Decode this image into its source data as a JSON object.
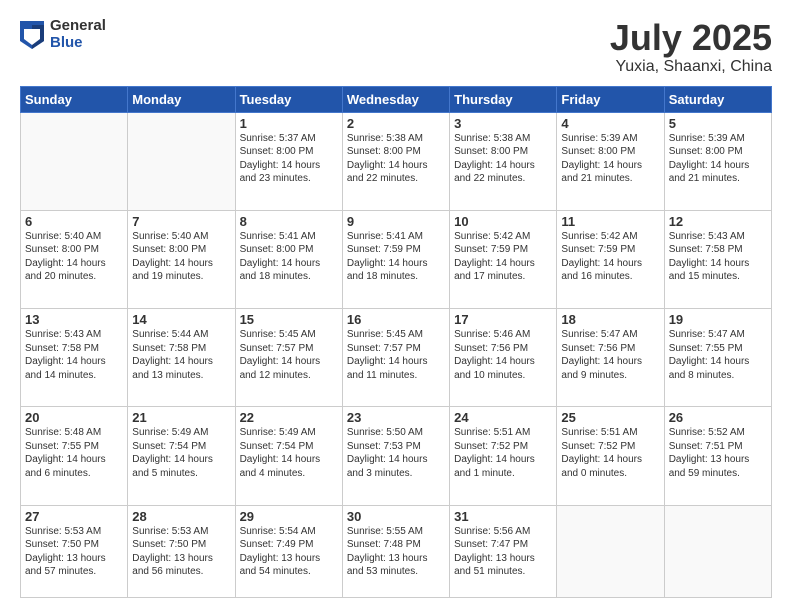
{
  "header": {
    "logo_general": "General",
    "logo_blue": "Blue",
    "month": "July 2025",
    "location": "Yuxia, Shaanxi, China"
  },
  "weekdays": [
    "Sunday",
    "Monday",
    "Tuesday",
    "Wednesday",
    "Thursday",
    "Friday",
    "Saturday"
  ],
  "weeks": [
    [
      {
        "day": "",
        "info": ""
      },
      {
        "day": "",
        "info": ""
      },
      {
        "day": "1",
        "info": "Sunrise: 5:37 AM\nSunset: 8:00 PM\nDaylight: 14 hours\nand 23 minutes."
      },
      {
        "day": "2",
        "info": "Sunrise: 5:38 AM\nSunset: 8:00 PM\nDaylight: 14 hours\nand 22 minutes."
      },
      {
        "day": "3",
        "info": "Sunrise: 5:38 AM\nSunset: 8:00 PM\nDaylight: 14 hours\nand 22 minutes."
      },
      {
        "day": "4",
        "info": "Sunrise: 5:39 AM\nSunset: 8:00 PM\nDaylight: 14 hours\nand 21 minutes."
      },
      {
        "day": "5",
        "info": "Sunrise: 5:39 AM\nSunset: 8:00 PM\nDaylight: 14 hours\nand 21 minutes."
      }
    ],
    [
      {
        "day": "6",
        "info": "Sunrise: 5:40 AM\nSunset: 8:00 PM\nDaylight: 14 hours\nand 20 minutes."
      },
      {
        "day": "7",
        "info": "Sunrise: 5:40 AM\nSunset: 8:00 PM\nDaylight: 14 hours\nand 19 minutes."
      },
      {
        "day": "8",
        "info": "Sunrise: 5:41 AM\nSunset: 8:00 PM\nDaylight: 14 hours\nand 18 minutes."
      },
      {
        "day": "9",
        "info": "Sunrise: 5:41 AM\nSunset: 7:59 PM\nDaylight: 14 hours\nand 18 minutes."
      },
      {
        "day": "10",
        "info": "Sunrise: 5:42 AM\nSunset: 7:59 PM\nDaylight: 14 hours\nand 17 minutes."
      },
      {
        "day": "11",
        "info": "Sunrise: 5:42 AM\nSunset: 7:59 PM\nDaylight: 14 hours\nand 16 minutes."
      },
      {
        "day": "12",
        "info": "Sunrise: 5:43 AM\nSunset: 7:58 PM\nDaylight: 14 hours\nand 15 minutes."
      }
    ],
    [
      {
        "day": "13",
        "info": "Sunrise: 5:43 AM\nSunset: 7:58 PM\nDaylight: 14 hours\nand 14 minutes."
      },
      {
        "day": "14",
        "info": "Sunrise: 5:44 AM\nSunset: 7:58 PM\nDaylight: 14 hours\nand 13 minutes."
      },
      {
        "day": "15",
        "info": "Sunrise: 5:45 AM\nSunset: 7:57 PM\nDaylight: 14 hours\nand 12 minutes."
      },
      {
        "day": "16",
        "info": "Sunrise: 5:45 AM\nSunset: 7:57 PM\nDaylight: 14 hours\nand 11 minutes."
      },
      {
        "day": "17",
        "info": "Sunrise: 5:46 AM\nSunset: 7:56 PM\nDaylight: 14 hours\nand 10 minutes."
      },
      {
        "day": "18",
        "info": "Sunrise: 5:47 AM\nSunset: 7:56 PM\nDaylight: 14 hours\nand 9 minutes."
      },
      {
        "day": "19",
        "info": "Sunrise: 5:47 AM\nSunset: 7:55 PM\nDaylight: 14 hours\nand 8 minutes."
      }
    ],
    [
      {
        "day": "20",
        "info": "Sunrise: 5:48 AM\nSunset: 7:55 PM\nDaylight: 14 hours\nand 6 minutes."
      },
      {
        "day": "21",
        "info": "Sunrise: 5:49 AM\nSunset: 7:54 PM\nDaylight: 14 hours\nand 5 minutes."
      },
      {
        "day": "22",
        "info": "Sunrise: 5:49 AM\nSunset: 7:54 PM\nDaylight: 14 hours\nand 4 minutes."
      },
      {
        "day": "23",
        "info": "Sunrise: 5:50 AM\nSunset: 7:53 PM\nDaylight: 14 hours\nand 3 minutes."
      },
      {
        "day": "24",
        "info": "Sunrise: 5:51 AM\nSunset: 7:52 PM\nDaylight: 14 hours\nand 1 minute."
      },
      {
        "day": "25",
        "info": "Sunrise: 5:51 AM\nSunset: 7:52 PM\nDaylight: 14 hours\nand 0 minutes."
      },
      {
        "day": "26",
        "info": "Sunrise: 5:52 AM\nSunset: 7:51 PM\nDaylight: 13 hours\nand 59 minutes."
      }
    ],
    [
      {
        "day": "27",
        "info": "Sunrise: 5:53 AM\nSunset: 7:50 PM\nDaylight: 13 hours\nand 57 minutes."
      },
      {
        "day": "28",
        "info": "Sunrise: 5:53 AM\nSunset: 7:50 PM\nDaylight: 13 hours\nand 56 minutes."
      },
      {
        "day": "29",
        "info": "Sunrise: 5:54 AM\nSunset: 7:49 PM\nDaylight: 13 hours\nand 54 minutes."
      },
      {
        "day": "30",
        "info": "Sunrise: 5:55 AM\nSunset: 7:48 PM\nDaylight: 13 hours\nand 53 minutes."
      },
      {
        "day": "31",
        "info": "Sunrise: 5:56 AM\nSunset: 7:47 PM\nDaylight: 13 hours\nand 51 minutes."
      },
      {
        "day": "",
        "info": ""
      },
      {
        "day": "",
        "info": ""
      }
    ]
  ]
}
